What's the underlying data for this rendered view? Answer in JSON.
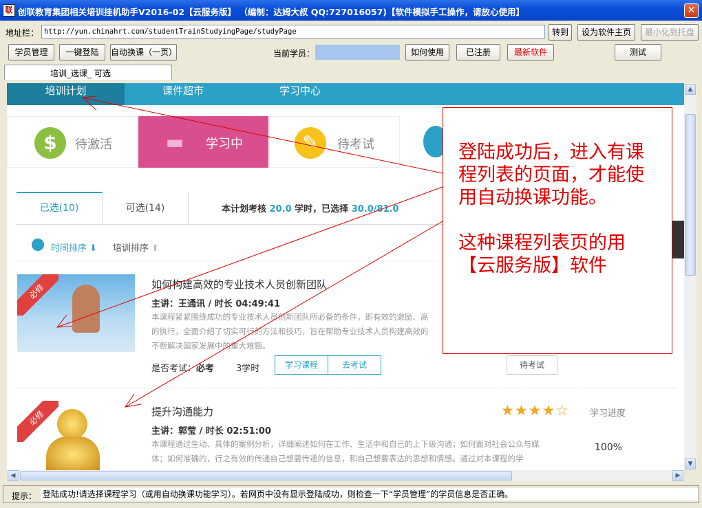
{
  "window": {
    "title": "创联教育集团相关培训挂机助手V2016-02【云服务版】 （编制：达姆大叔 QQ:727016057)【软件模拟手工操作，请放心使用】",
    "icon_text": "联",
    "close_glyph": "✕"
  },
  "addressbar": {
    "label": "地址栏：",
    "url": "http://yun.chinahrt.com/studentTrainStudyingPage/studyPage",
    "go": "转到",
    "set_home": "设为软件主页",
    "minimize_tray": "最小化到托盘"
  },
  "toolbar": {
    "student_mgmt": "学员管理",
    "one_click_login": "一键登陆",
    "auto_switch": "自动换课（一页）",
    "current_student_label": "当前学员：",
    "current_student_value": "",
    "how_to_use": "如何使用",
    "registered": "已注册",
    "latest_software": "最新软件",
    "test": "测试"
  },
  "doc_tab": "培训_选课_ 可选",
  "site": {
    "nav": [
      "培训计划",
      "课件超市",
      "学习中心"
    ],
    "status_tiles": [
      {
        "label": "待激活",
        "glyph": "$",
        "color": "#8cc043"
      },
      {
        "label": "学习中",
        "glyph": "▬",
        "color": "#d94f8e"
      },
      {
        "label": "待考试",
        "glyph": "✎",
        "color": "#f7c31b"
      }
    ],
    "tabs": {
      "selected": "已选(10)",
      "optional": "可选(14)",
      "summary_prefix": "本计划考核",
      "hours_required": "20.0",
      "summary_mid": "学时，已选择",
      "hours_selected": "30.0/81.0"
    },
    "sort": {
      "time": "时间排序",
      "training": "培训排序"
    },
    "courses": [
      {
        "badge": "必修",
        "title": "如何构建高效的专业技术人员创新团队",
        "lecturer": "主讲：王通讯 / 时长 04:49:41",
        "desc_lines": [
          "本课程紧紧围绕成功的专业技术人员创新团队所必备的条件，即有效的激励、高",
          "的执行，全面介绍了切实可行的方法和技巧，旨在帮助专业技术人员构建高效的",
          "不断解决国家发展中的重大难题。"
        ],
        "exam_label": "是否考试：",
        "exam_value": "必考",
        "hours": "3学时",
        "study_btn": "学习课程",
        "exam_btn": "去考试",
        "status_btn": "待考试"
      },
      {
        "badge": "必修",
        "title": "提升沟通能力",
        "lecturer": "主讲：郭莹 / 时长 02:51:00",
        "desc_lines": [
          "本课程通过生动、具体的案例分析，详细阐述如何在工作、生活中和自己的上下级沟通；如何面对社会公众与媒",
          "体；如何准确的，行之有效的传递自己想要传递的信息，和自己想要表达的思想和情感。通过对本课程的学"
        ],
        "rating": 4,
        "stars": "★★★★☆",
        "progress_label": "学习进度",
        "progress": "100%"
      }
    ]
  },
  "callout": {
    "para1": "登陆成功后，进入有课程列表的页面，才能使用自动换课功能。",
    "para2": "这种课程列表页的用【云服务版】软件"
  },
  "scroll": {
    "up": "▲",
    "down": "▼",
    "left": "◀",
    "right": "▶"
  },
  "status": {
    "label": "提示：",
    "text": "登陆成功!请选择课程学习（或用自动换课功能学习）。若网页中没有显示登陆成功，则检查一下“学员管理”的学员信息是否正确。"
  }
}
